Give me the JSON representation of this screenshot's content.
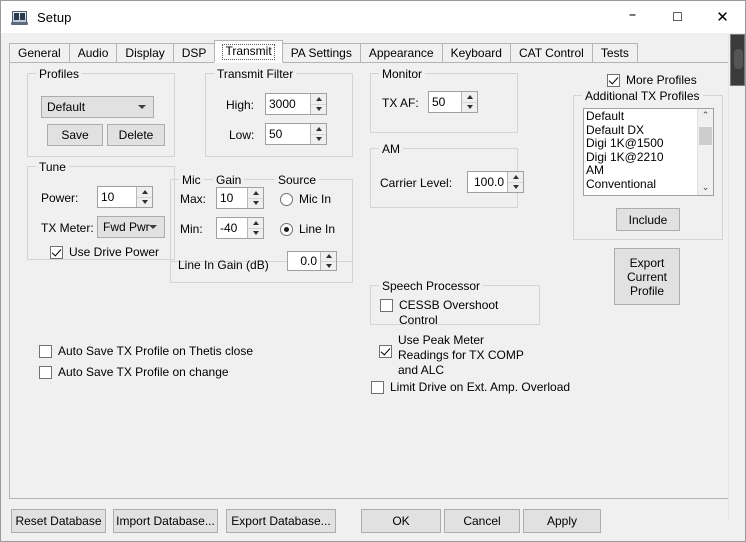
{
  "window": {
    "title": "Setup",
    "icon": "radio-transceiver-icon",
    "minimize": "–",
    "maximize": "☐",
    "close": "✕"
  },
  "tabs": [
    {
      "label": "General",
      "selected": false
    },
    {
      "label": "Audio",
      "selected": false
    },
    {
      "label": "Display",
      "selected": false
    },
    {
      "label": "DSP",
      "selected": false
    },
    {
      "label": "Transmit",
      "selected": true
    },
    {
      "label": "PA Settings",
      "selected": false
    },
    {
      "label": "Appearance",
      "selected": false
    },
    {
      "label": "Keyboard",
      "selected": false
    },
    {
      "label": "CAT Control",
      "selected": false
    },
    {
      "label": "Tests",
      "selected": false
    }
  ],
  "profiles": {
    "caption": "Profiles",
    "selected": "Default",
    "save_label": "Save",
    "delete_label": "Delete"
  },
  "tune": {
    "caption": "Tune",
    "power_label": "Power:",
    "power_value": "10",
    "tx_meter_label": "TX Meter:",
    "tx_meter_value": "Fwd Pwr",
    "use_drive_power_label": "Use Drive Power",
    "use_drive_power_checked": true
  },
  "transmit_filter": {
    "caption": "Transmit Filter",
    "high_label": "High:",
    "high_value": "3000",
    "low_label": "Low:",
    "low_value": "50"
  },
  "mic_gain": {
    "caption_mic": "Mic",
    "caption_gain": "Gain",
    "max_label": "Max:",
    "max_value": "10",
    "min_label": "Min:",
    "min_value": "-40",
    "line_in_gain_label": "Line In Gain (dB)",
    "line_in_gain_value": "0.0"
  },
  "source": {
    "caption": "Source",
    "mic_in_label": "Mic In",
    "line_in_label": "Line In",
    "selected": "Line In"
  },
  "monitor": {
    "caption": "Monitor",
    "tx_af_label": "TX AF:",
    "tx_af_value": "50"
  },
  "am": {
    "caption": "AM",
    "carrier_level_label": "Carrier Level:",
    "carrier_level_value": "100.0"
  },
  "speech_processor": {
    "caption": "Speech Processor",
    "cessb_label": "CESSB Overshoot Control",
    "cessb_checked": false,
    "peak_meter_label": "Use Peak Meter\nReadings for TX COMP\nand ALC",
    "peak_meter_checked": true,
    "limit_drive_label": "Limit Drive on Ext. Amp. Overload",
    "limit_drive_checked": false
  },
  "auto_save": {
    "on_close_label": "Auto Save TX Profile on Thetis close",
    "on_close_checked": false,
    "on_change_label": "Auto Save TX Profile on change",
    "on_change_checked": false
  },
  "more_profiles": {
    "label": "More Profiles",
    "checked": true
  },
  "additional_profiles": {
    "caption": "Additional TX Profiles",
    "items": [
      "Default",
      "Default DX",
      "Digi 1K@1500",
      "Digi 1K@2210",
      "AM",
      "Conventional"
    ],
    "scroll_up_icon": "⌃",
    "scroll_down_icon": "⌄",
    "include_label": "Include"
  },
  "export_current_profile": {
    "label": "Export\nCurrent\nProfile"
  },
  "bottom_buttons": {
    "reset_database": "Reset Database",
    "import_database": "Import Database...",
    "export_database": "Export Database...",
    "ok": "OK",
    "cancel": "Cancel",
    "apply": "Apply"
  }
}
